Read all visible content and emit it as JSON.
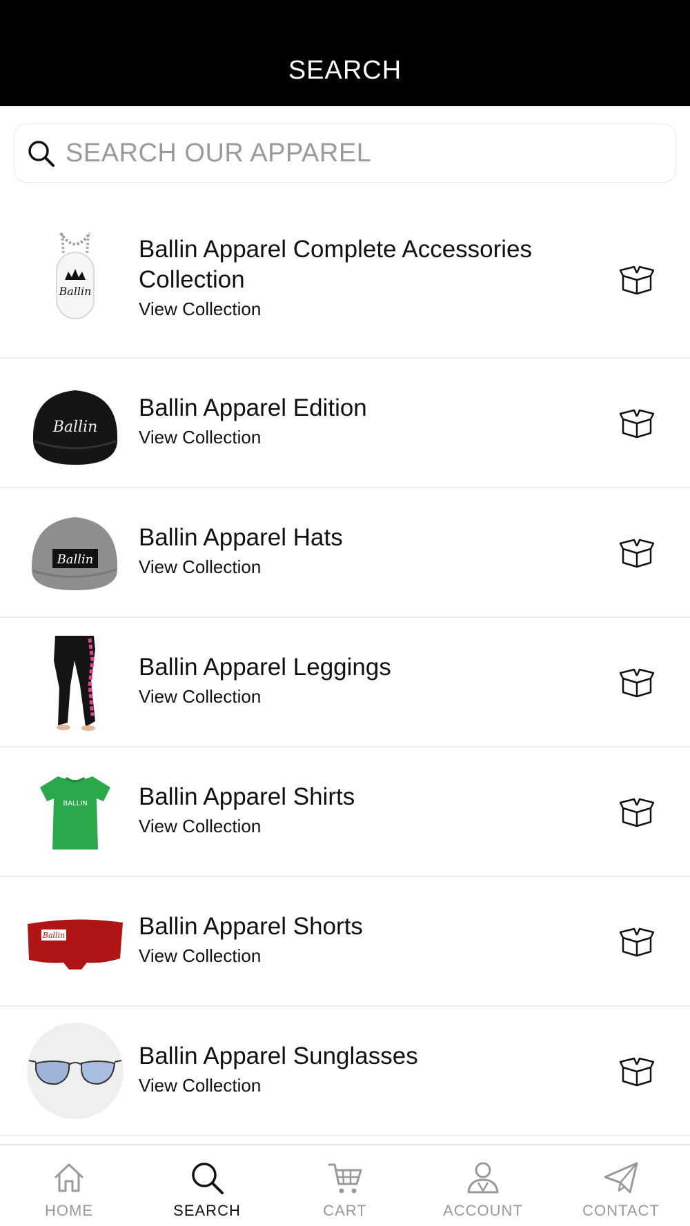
{
  "header": {
    "title": "SEARCH"
  },
  "search": {
    "placeholder": "SEARCH OUR APPAREL",
    "value": ""
  },
  "collections": [
    {
      "title": "Ballin Apparel Complete Accessories Collection",
      "action": "View Collection",
      "thumb": "dog-tag-image"
    },
    {
      "title": "Ballin Apparel Edition",
      "action": "View Collection",
      "thumb": "black-cap-image"
    },
    {
      "title": "Ballin Apparel Hats",
      "action": "View Collection",
      "thumb": "grey-cap-image"
    },
    {
      "title": "Ballin Apparel Leggings",
      "action": "View Collection",
      "thumb": "leggings-image"
    },
    {
      "title": "Ballin Apparel Shirts",
      "action": "View Collection",
      "thumb": "green-shirt-image"
    },
    {
      "title": "Ballin Apparel Shorts",
      "action": "View Collection",
      "thumb": "red-shorts-image"
    },
    {
      "title": "Ballin Apparel Sunglasses",
      "action": "View Collection",
      "thumb": "sunglasses-image"
    }
  ],
  "nav": {
    "items": [
      {
        "label": "HOME",
        "icon": "home-icon",
        "active": false
      },
      {
        "label": "SEARCH",
        "icon": "search-icon",
        "active": true
      },
      {
        "label": "CART",
        "icon": "cart-icon",
        "active": false
      },
      {
        "label": "ACCOUNT",
        "icon": "account-icon",
        "active": false
      },
      {
        "label": "CONTACT",
        "icon": "paper-plane-icon",
        "active": false
      }
    ]
  },
  "colors": {
    "header_bg": "#000000",
    "active": "#111111",
    "inactive": "#999999",
    "divider": "#efefef"
  }
}
